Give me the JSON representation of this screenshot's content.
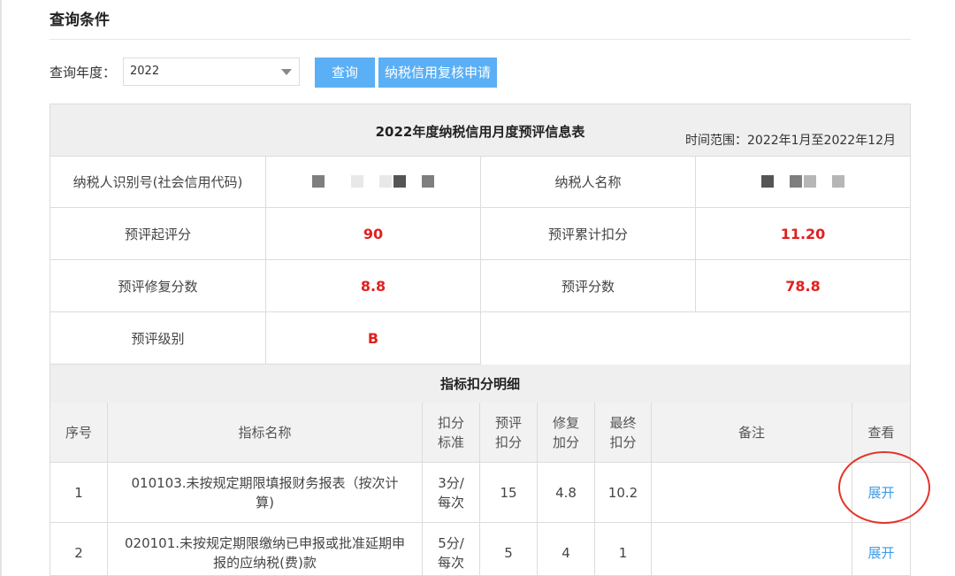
{
  "query_section": {
    "title": "查询条件",
    "year_label": "查询年度：",
    "year_value": "2022",
    "query_button": "查询",
    "review_button": "纳税信用复核申请"
  },
  "info_table": {
    "title": "2022年度纳税信用月度预评信息表",
    "time_range": "时间范围：2022年1月至2022年12月",
    "rows": [
      {
        "label_left": "纳税人识别号(社会信用代码)",
        "value_left": "",
        "label_right": "纳税人名称",
        "value_right": ""
      },
      {
        "label_left": "预评起评分",
        "value_left": "90",
        "label_right": "预评累计扣分",
        "value_right": "11.20"
      },
      {
        "label_left": "预评修复分数",
        "value_left": "8.8",
        "label_right": "预评分数",
        "value_right": "78.8"
      },
      {
        "label_left": "预评级别",
        "value_left": "B"
      }
    ]
  },
  "detail_table": {
    "title": "指标扣分明细",
    "columns": [
      "序号",
      "指标名称",
      "扣分标准",
      "预评扣分",
      "修复加分",
      "最终扣分",
      "备注",
      "查看"
    ],
    "rows": [
      {
        "index": "1",
        "name": "010103.未按规定期限填报财务报表（按次计算)",
        "standard": "3分/每次",
        "pre_deduct": "15",
        "repair": "4.8",
        "final": "10.2",
        "note": "",
        "action": "展开"
      },
      {
        "index": "2",
        "name": "020101.未按规定期限缴纳已申报或批准延期申报的应纳税(费)款",
        "standard": "5分/每次",
        "pre_deduct": "5",
        "repair": "4",
        "final": "1",
        "note": "",
        "action": "展开"
      }
    ]
  },
  "colors": {
    "accent_button": "#5aaff5",
    "value_red": "#e02020",
    "link_blue": "#3c9ce8",
    "annotation_red": "#e4342a",
    "header_gray": "#efefef"
  }
}
